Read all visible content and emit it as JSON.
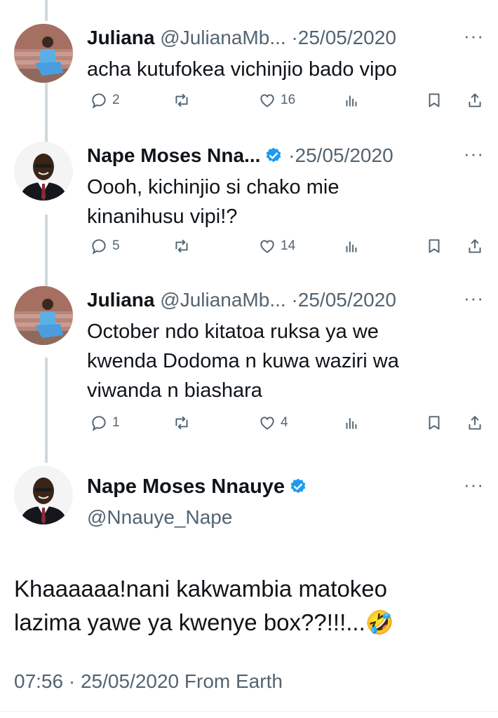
{
  "replies": [
    {
      "name": "Juliana",
      "handle": "@JulianaMb...",
      "sep": "·",
      "date": "25/05/2020",
      "text_lines": [
        "acha kutufokea vichinjio bado vipo"
      ],
      "replies": "2",
      "likes": "16",
      "verified": false
    },
    {
      "name": "Nape Moses Nna...",
      "handle": "",
      "sep": "·",
      "date": "25/05/2020",
      "text_lines": [
        "Oooh, kichinjio si chako mie",
        "kinanihusu vipi!?"
      ],
      "replies": "5",
      "likes": "14",
      "verified": true
    },
    {
      "name": "Juliana",
      "handle": "@JulianaMb...",
      "sep": "·",
      "date": "25/05/2020",
      "text_lines": [
        "October ndo kitatoa ruksa ya we",
        "kwenda Dodoma n kuwa waziri wa",
        "viwanda n biashara"
      ],
      "replies": "1",
      "likes": "4",
      "verified": false
    }
  ],
  "main_tweet": {
    "name": "Nape Moses Nnauye",
    "handle": "@Nnauye_Nape",
    "text_lines": [
      "Khaaaaaa!nani kakwambia matokeo",
      "lazima yawe ya kwenye box??!!!...🤣"
    ],
    "time": "07:56",
    "sep": "·",
    "date": "25/05/2020",
    "source": "From Earth"
  },
  "icons": {
    "more": "more-dots-icon",
    "reply": "reply-icon",
    "retweet": "retweet-icon",
    "like": "heart-icon",
    "views": "views-icon",
    "bookmark": "bookmark-icon",
    "share": "share-icon"
  },
  "colors": {
    "verified": "#1d9bf0",
    "muted": "#536471",
    "thread_line": "#cfd9de"
  }
}
